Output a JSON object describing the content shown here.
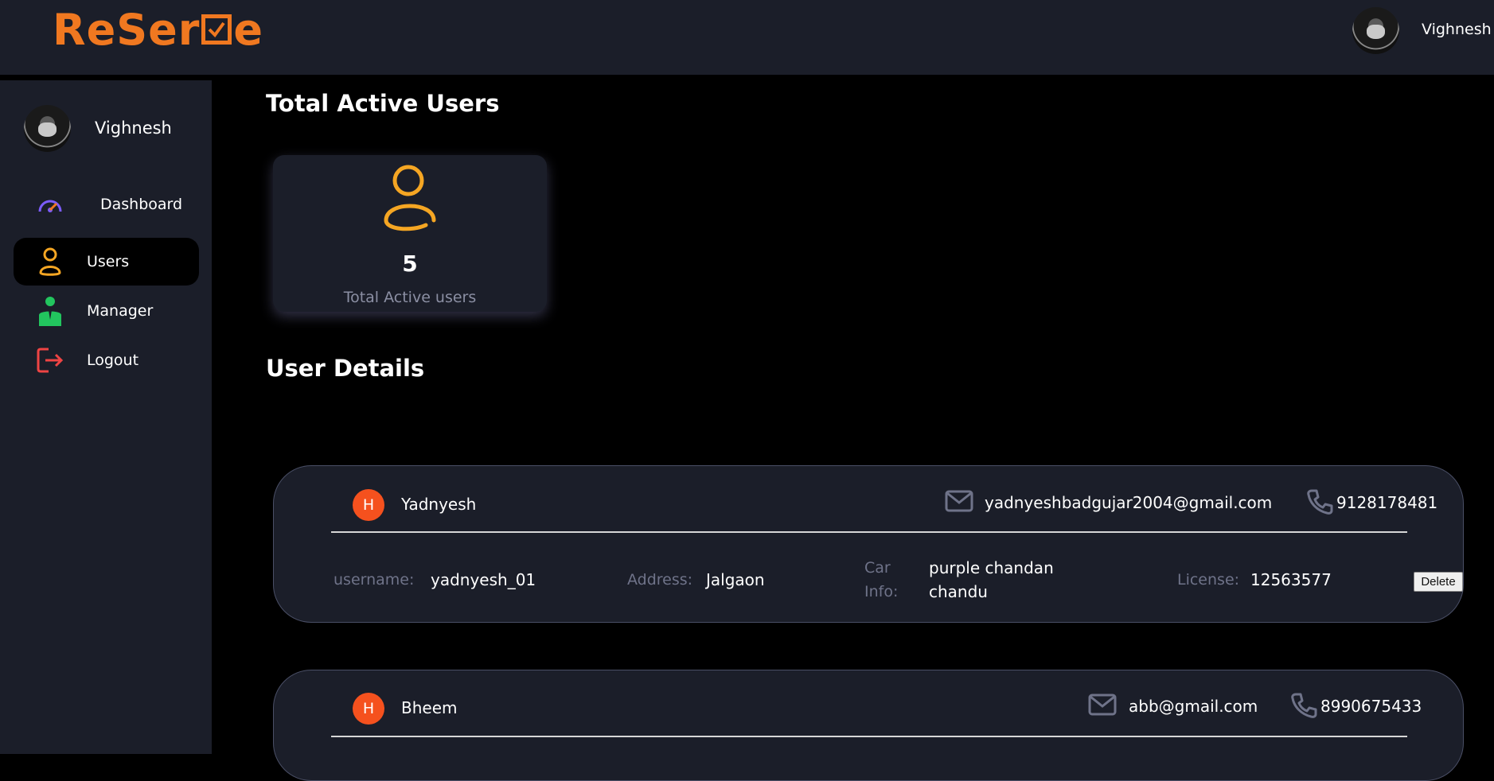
{
  "header": {
    "logo_text": "ReServe",
    "logo_prefix": "ReSer",
    "logo_suffix": "e",
    "user_name": "Vighnesh"
  },
  "sidebar": {
    "user_name": "Vighnesh",
    "items": [
      {
        "label": "Dashboard",
        "icon": "speedometer-icon",
        "active": false
      },
      {
        "label": "Users",
        "icon": "user-icon",
        "active": true
      },
      {
        "label": "Manager",
        "icon": "manager-icon",
        "active": false
      },
      {
        "label": "Logout",
        "icon": "logout-icon",
        "active": false
      }
    ]
  },
  "main": {
    "title": "Total Active Users",
    "stat": {
      "value": "5",
      "label": "Total Active users"
    },
    "details_title": "User Details",
    "users": [
      {
        "avatar_letter": "H",
        "name": "Yadnyesh",
        "email": "yadnyeshbadgujar2004@gmail.com",
        "phone": "9128178481",
        "username_label": "username:",
        "username": "yadnyesh_01",
        "address_label": "Address:",
        "address": "Jalgaon",
        "car_label_1": "Car",
        "car_label_2": "Info:",
        "car_1": "purple chandan",
        "car_2": "chandu",
        "license_label": "License:",
        "license": "12563577",
        "delete_label": "Delete"
      },
      {
        "avatar_letter": "H",
        "name": "Bheem",
        "email": "abb@gmail.com",
        "phone": "8990675433"
      }
    ]
  },
  "colors": {
    "accent": "#f07820",
    "icon_yellow": "#f5a623",
    "badge": "#f5511e",
    "panel": "#1b1e29",
    "manager_green": "#22c55e",
    "logout_red": "#ef4444",
    "dashboard_purple": "#7c5cff"
  }
}
